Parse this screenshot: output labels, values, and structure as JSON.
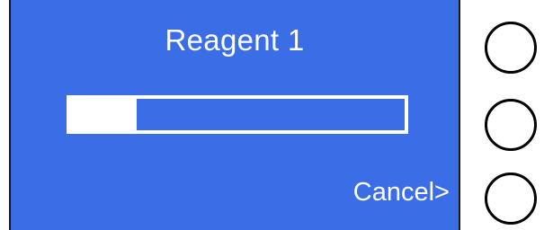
{
  "screen": {
    "title": "Reagent 1",
    "progress_fraction": 0.2,
    "cancel_label": "Cancel>",
    "background_color": "#3b6de6",
    "text_color": "#ffffff"
  },
  "softkeys": [
    {
      "icon": "circle-button"
    },
    {
      "icon": "circle-button"
    },
    {
      "icon": "circle-button"
    }
  ]
}
